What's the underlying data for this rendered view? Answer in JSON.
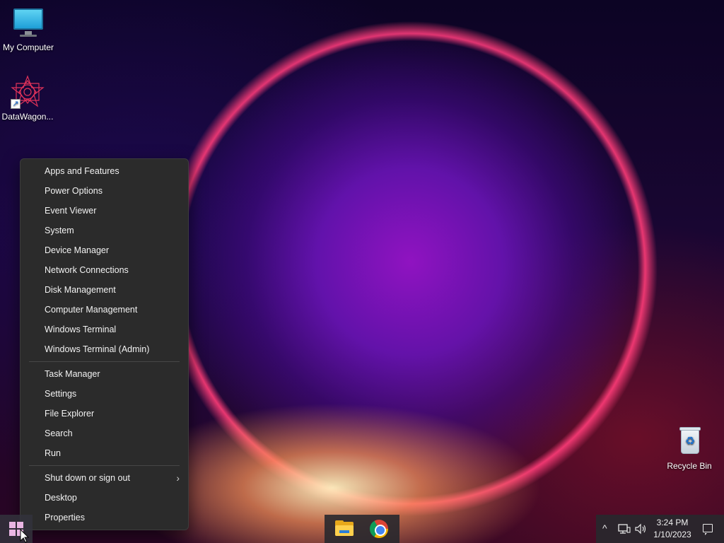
{
  "desktop": {
    "icons": [
      {
        "label": "My Computer"
      },
      {
        "label": "DataWagon..."
      },
      {
        "label": "Recycle Bin"
      }
    ]
  },
  "context_menu": {
    "group1": [
      "Apps and Features",
      "Power Options",
      "Event Viewer",
      "System",
      "Device Manager",
      "Network Connections",
      "Disk Management",
      "Computer Management",
      "Windows Terminal",
      "Windows Terminal (Admin)"
    ],
    "group2": [
      "Task Manager",
      "Settings",
      "File Explorer",
      "Search",
      "Run"
    ],
    "group3": [
      "Shut down or sign out",
      "Desktop",
      "Properties"
    ],
    "submenu_chevron": "›"
  },
  "taskbar": {
    "apps": [
      "file-explorer",
      "google-chrome"
    ],
    "tray": {
      "chevron": "^",
      "time": "3:24 PM",
      "date": "1/10/2023"
    }
  },
  "colors": {
    "menu_bg": "#2b2b2b",
    "start_logo": "#e9b5e3"
  }
}
